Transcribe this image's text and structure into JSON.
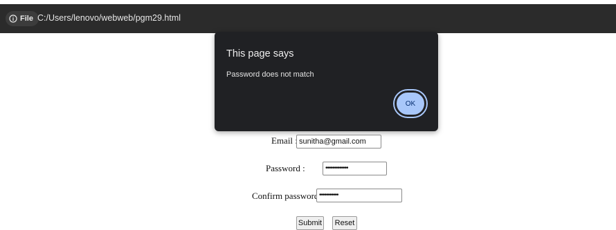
{
  "browser": {
    "file_chip_label": "File",
    "url": "C:/Users/lenovo/webweb/pgm29.html"
  },
  "dialog": {
    "title": "This page says",
    "message": "Password does not match",
    "ok_label": "OK"
  },
  "form": {
    "email_label": "Email :",
    "email_value": "sunitha@gmail.com",
    "password_label": "Password :",
    "password_value": "•••••••••••••",
    "confirm_label": "Confirm password :",
    "confirm_value": "•••••••••••",
    "submit_label": "Submit",
    "reset_label": "Reset"
  },
  "colors": {
    "topbar": "#2b2b2b",
    "dialog_bg": "#202124",
    "ok_button": "#a8c7fa"
  }
}
